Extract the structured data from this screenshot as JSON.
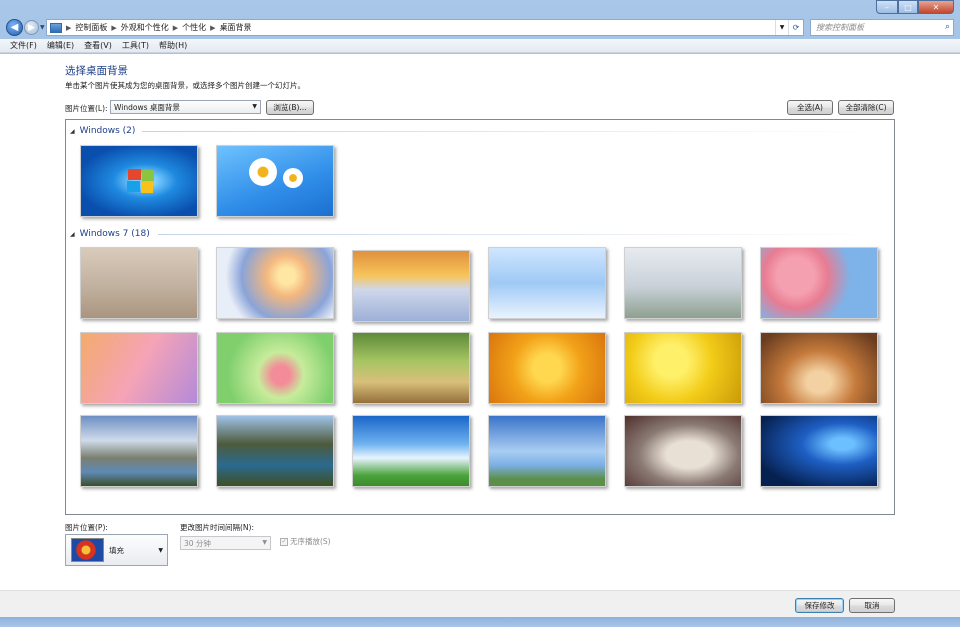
{
  "window": {
    "caption": {
      "min": "–",
      "max": "□",
      "close": "✕"
    }
  },
  "nav": {
    "back_glyph": "◀",
    "forward_glyph": "▶",
    "breadcrumbs": [
      "控制面板",
      "外观和个性化",
      "个性化",
      "桌面背景"
    ],
    "search_placeholder": "搜索控制面板"
  },
  "menu": [
    "文件(F)",
    "编辑(E)",
    "查看(V)",
    "工具(T)",
    "帮助(H)"
  ],
  "page": {
    "title": "选择桌面背景",
    "description": "单击某个图片使其成为您的桌面背景，或选择多个图片创建一个幻灯片。",
    "location_label": "图片位置(L):",
    "location_value": "Windows 桌面背景",
    "browse_label": "浏览(B)...",
    "select_all_label": "全选(A)",
    "clear_all_label": "全部清除(C)"
  },
  "groups": [
    {
      "title": "Windows (2)",
      "arrow": "◢",
      "thumbs": [
        "win7-logo-blue",
        "daisies-blue"
      ]
    },
    {
      "title": "Windows 7 (18)",
      "arrow": "◢",
      "thumbs": [
        "sepia-snow-lantern",
        "snowy-trees-sunset",
        "snow-footprints-sunset",
        "icy-branches",
        "frost-grass",
        "cherry-blossoms",
        "pink-flowers-macro",
        "pink-flower-green",
        "meadow-path-sunlit",
        "yellow-ginkgo",
        "yellow-ginkgo-leaves",
        "autumn-forest-road",
        "mountain-lake",
        "mountain-lake-reflection",
        "blue-sky-clouds",
        "wind-turbine-sky",
        "girl-winter",
        "windows-10-blue"
      ]
    }
  ],
  "options": {
    "position_label": "图片位置(P):",
    "position_value": "填充",
    "interval_label": "更改图片时间间隔(N):",
    "interval_value": "30 分钟",
    "shuffle_label": "无序播放(S)",
    "shuffle_checked": true
  },
  "footer": {
    "save_label": "保存修改",
    "cancel_label": "取消"
  }
}
